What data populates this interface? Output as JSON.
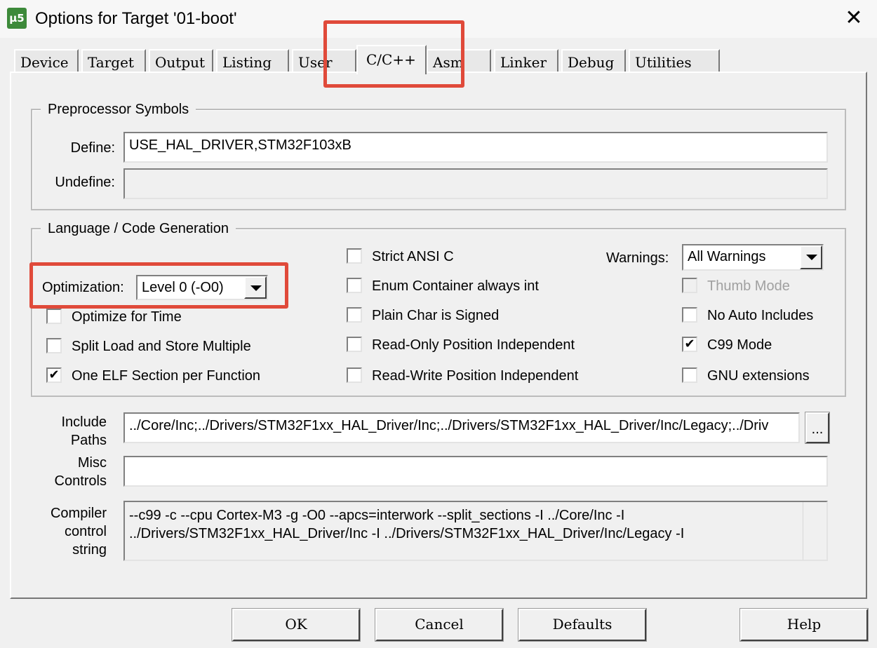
{
  "window": {
    "title": "Options for Target '01-boot'",
    "app_icon_text": "µ5",
    "close_glyph": "✕"
  },
  "tabs": [
    "Device",
    "Target",
    "Output",
    "Listing",
    "User",
    "C/C++",
    "Asm",
    "Linker",
    "Debug",
    "Utilities"
  ],
  "active_tab": "C/C++",
  "preprocessor": {
    "title": "Preprocessor Symbols",
    "define_label": "Define:",
    "define_value": "USE_HAL_DRIVER,STM32F103xB",
    "undefine_label": "Undefine:",
    "undefine_value": ""
  },
  "language": {
    "title": "Language / Code Generation",
    "optimization_label": "Optimization:",
    "optimization_value": "Level 0 (-O0)",
    "warnings_label": "Warnings:",
    "warnings_value": "All Warnings",
    "checkboxes": {
      "optimize_time": {
        "label": "Optimize for Time",
        "checked": false
      },
      "split_load": {
        "label": "Split Load and Store Multiple",
        "checked": false
      },
      "one_elf": {
        "label": "One ELF Section per Function",
        "checked": true
      },
      "strict_ansi": {
        "label": "Strict ANSI C",
        "checked": false
      },
      "enum_container": {
        "label": "Enum Container always int",
        "checked": false
      },
      "plain_char": {
        "label": "Plain Char is Signed",
        "checked": false
      },
      "ro_pi": {
        "label": "Read-Only Position Independent",
        "checked": false
      },
      "rw_pi": {
        "label": "Read-Write Position Independent",
        "checked": false
      },
      "thumb_mode": {
        "label": "Thumb Mode",
        "checked": false,
        "disabled": true
      },
      "no_auto_includes": {
        "label": "No Auto Includes",
        "checked": false
      },
      "c99_mode": {
        "label": "C99 Mode",
        "checked": true
      },
      "gnu_extensions": {
        "label": "GNU extensions",
        "checked": false
      }
    }
  },
  "include_paths": {
    "label_line1": "Include",
    "label_line2": "Paths",
    "value": "../Core/Inc;../Drivers/STM32F1xx_HAL_Driver/Inc;../Drivers/STM32F1xx_HAL_Driver/Inc/Legacy;../Driv",
    "browse_label": "..."
  },
  "misc_controls": {
    "label_line1": "Misc",
    "label_line2": "Controls",
    "value": ""
  },
  "compiler_string": {
    "label_line1": "Compiler",
    "label_line2": "control",
    "label_line3": "string",
    "value": "--c99 -c --cpu Cortex-M3 -g -O0 --apcs=interwork --split_sections -I ../Core/Inc -I ../Drivers/STM32F1xx_HAL_Driver/Inc -I ../Drivers/STM32F1xx_HAL_Driver/Inc/Legacy -I"
  },
  "buttons": {
    "ok": "OK",
    "cancel": "Cancel",
    "defaults": "Defaults",
    "help": "Help"
  },
  "colors": {
    "highlight_box": "#e04a3a",
    "window_bg": "#f0f0f0"
  }
}
